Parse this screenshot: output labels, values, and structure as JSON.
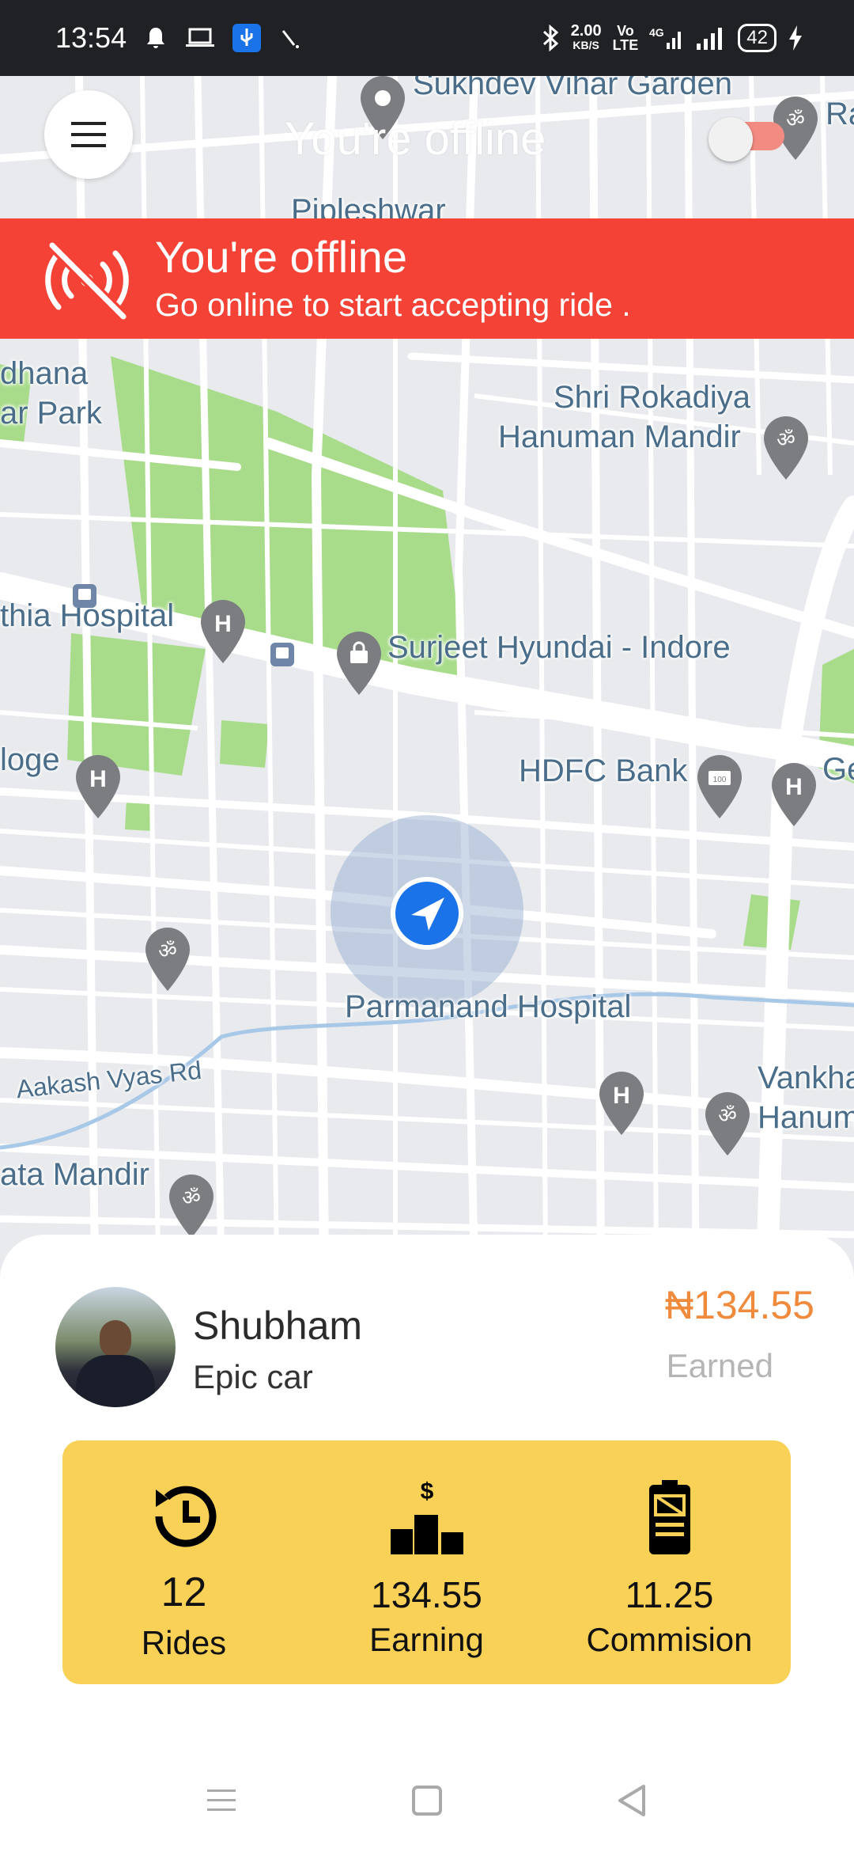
{
  "status_bar": {
    "time": "13:54",
    "net_speed": "2.00",
    "net_speed_unit": "KB/S",
    "volte": "Vo\nLTE",
    "network": "4G",
    "battery": "42",
    "icons": [
      "bell-icon",
      "laptop-icon",
      "usb-icon",
      "signal-slash-icon",
      "bluetooth-icon",
      "wifi-signal-icon",
      "charging-icon"
    ]
  },
  "header": {
    "menu_icon": "hamburger-icon",
    "title": "You're offline",
    "toggle_state": "off"
  },
  "banner": {
    "icon": "offline-signal-icon",
    "title": "You're offline",
    "subtitle": "Go online to start accepting ride ."
  },
  "map": {
    "labels": {
      "sukhdev": "Sukhdev Vihar Garden",
      "pipleshwar": "Pipleshwar",
      "rokadiya_1": "Shri Rokadiya",
      "rokadiya_2": "Hanuman Mandir",
      "dhana_1": "dhana",
      "dhana_2": "ar Park",
      "hospital_left": "thia Hospital",
      "surjeet": "Surjeet Hyundai - Indore",
      "loge": "loge",
      "hdfc": "HDFC Bank",
      "ge": "Ge",
      "parmanand": "Parmanand Hospital",
      "aakash": "Aakash Vyas Rd",
      "vankha_1": "Vankha",
      "vankha_2": "Hanum",
      "ata_mandir": "ata Mandir",
      "ra": "Ra"
    }
  },
  "driver": {
    "name": "Shubham",
    "car": "Epic car",
    "earned_amount": "₦134.55",
    "earned_label": "Earned"
  },
  "stats": [
    {
      "icon": "history-icon",
      "value": "12",
      "label": "Rides"
    },
    {
      "icon": "earnings-podium-icon",
      "value": "134.55",
      "label": "Earning"
    },
    {
      "icon": "commission-receipt-icon",
      "value": "11.25",
      "label": "Commision"
    }
  ],
  "colors": {
    "banner": "#f44336",
    "stats_bg": "#f9d157",
    "earned": "#f08a3c",
    "location": "#1a73e8"
  }
}
